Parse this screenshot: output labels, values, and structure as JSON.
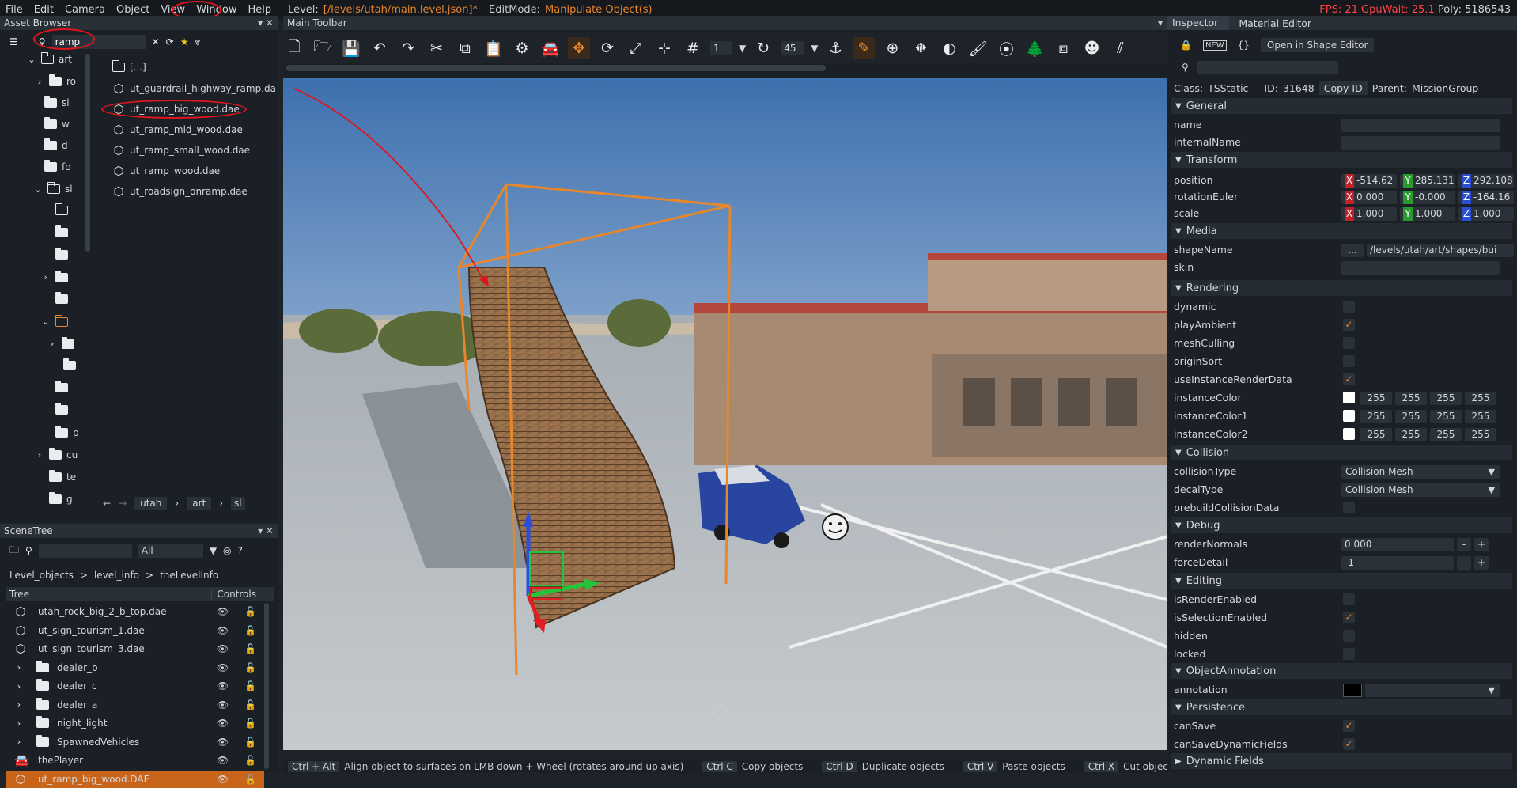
{
  "menubar": {
    "items": [
      "File",
      "Edit",
      "Camera",
      "Object",
      "View",
      "Window",
      "Help"
    ],
    "level_label": "Level:",
    "level_value": "[/levels/utah/main.level.json]*",
    "editmode_label": "EditMode:",
    "editmode_value": "Manipulate Object(s)",
    "fps": "FPS: 21",
    "gpuwait": "GpuWait: 25.1",
    "poly": "Poly: 5186543"
  },
  "asset_browser": {
    "title": "Asset Browser",
    "search_value": "ramp",
    "tree": [
      "art",
      "ro",
      "sl",
      "w",
      "d",
      "fo",
      "sl",
      "p",
      "cu",
      "te",
      "g"
    ],
    "files": [
      "[...]",
      "ut_guardrail_highway_ramp.da",
      "ut_ramp_big_wood.dae",
      "ut_ramp_mid_wood.dae",
      "ut_ramp_small_wood.dae",
      "ut_ramp_wood.dae",
      "ut_roadsign_onramp.dae"
    ],
    "breadcrumb": [
      "utah",
      "art",
      "sl"
    ]
  },
  "scene_tree": {
    "title": "SceneTree",
    "filter_value": "All",
    "path": [
      "Level_objects",
      "level_info",
      "theLevelInfo"
    ],
    "col_tree": "Tree",
    "col_controls": "Controls",
    "rows": [
      {
        "label": "utah_rock_big_2_b_top.dae",
        "kind": "cube"
      },
      {
        "label": "ut_sign_tourism_1.dae",
        "kind": "cube"
      },
      {
        "label": "ut_sign_tourism_3.dae",
        "kind": "cube"
      },
      {
        "label": "dealer_b",
        "kind": "folder"
      },
      {
        "label": "dealer_c",
        "kind": "folder"
      },
      {
        "label": "dealer_a",
        "kind": "folder"
      },
      {
        "label": "night_light",
        "kind": "folder"
      },
      {
        "label": "SpawnedVehicles",
        "kind": "folder"
      },
      {
        "label": "thePlayer",
        "kind": "car"
      },
      {
        "label": "ut_ramp_big_wood.DAE",
        "kind": "cube"
      }
    ]
  },
  "main_toolbar": {
    "title": "Main Toolbar",
    "snap_value": "1",
    "rotate_snap_value": "45"
  },
  "inspector": {
    "tab_inspector": "Inspector",
    "tab_material": "Material Editor",
    "open_shape_editor": "Open in Shape Editor",
    "class_label": "Class:",
    "class_value": "TSStatic",
    "id_label": "ID:",
    "id_value": "31648",
    "copy_id": "Copy ID",
    "parent_label": "Parent:",
    "parent_value": "MissionGroup",
    "sec_general": "General",
    "name": "name",
    "internalName": "internalName",
    "sec_transform": "Transform",
    "position": "position",
    "pos": [
      "-514.62",
      "285.131",
      "292.108"
    ],
    "rotationEuler": "rotationEuler",
    "rot": [
      "0.000",
      "-0.000",
      "-164.16"
    ],
    "scale": "scale",
    "scl": [
      "1.000",
      "1.000",
      "1.000"
    ],
    "sec_media": "Media",
    "shapeName": "shapeName",
    "shape_btn": "...",
    "shape_value": "/levels/utah/art/shapes/bui",
    "skin": "skin",
    "sec_rendering": "Rendering",
    "dynamic": "dynamic",
    "playAmbient": "playAmbient",
    "meshCulling": "meshCulling",
    "originSort": "originSort",
    "useInstanceRenderData": "useInstanceRenderData",
    "instanceColor": "instanceColor",
    "instanceColor1": "instanceColor1",
    "instanceColor2": "instanceColor2",
    "c255": "255",
    "sec_collision": "Collision",
    "collisionType": "collisionType",
    "collisionType_value": "Collision Mesh",
    "decalType": "decalType",
    "decalType_value": "Collision Mesh",
    "prebuildCollisionData": "prebuildCollisionData",
    "sec_debug": "Debug",
    "renderNormals": "renderNormals",
    "renderNormals_value": "0.000",
    "forceDetail": "forceDetail",
    "forceDetail_value": "-1",
    "sec_editing": "Editing",
    "isRenderEnabled": "isRenderEnabled",
    "isSelectionEnabled": "isSelectionEnabled",
    "hidden": "hidden",
    "locked": "locked",
    "sec_objann": "ObjectAnnotation",
    "annotation": "annotation",
    "sec_persistence": "Persistence",
    "canSave": "canSave",
    "canSaveDynamicFields": "canSaveDynamicFields",
    "sec_dynamic": "Dynamic Fields"
  },
  "statusbar": {
    "k1": "Ctrl + Alt",
    "t1": "Align object to surfaces on LMB down + Wheel (rotates around up axis)",
    "k2": "Ctrl C",
    "t2": "Copy objects",
    "k3": "Ctrl D",
    "t3": "Duplicate objects",
    "k4": "Ctrl V",
    "t4": "Paste objects",
    "k5": "Ctrl X",
    "t5": "Cut objects"
  },
  "colors": {
    "accent": "#e8862b",
    "annotation": "#e0151d",
    "selected": "#c8651a"
  }
}
